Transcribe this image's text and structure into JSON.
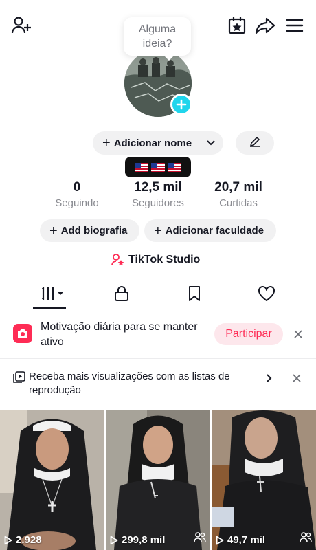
{
  "bubble": {
    "text": "Alguma ideia?"
  },
  "profile": {
    "add_name_label": "Adicionar nome",
    "flags": [
      "🇺🇸",
      "🇺🇸",
      "🇺🇸"
    ]
  },
  "stats": {
    "following": {
      "value": "0",
      "label": "Seguindo"
    },
    "followers": {
      "value": "12,5 mil",
      "label": "Seguidores"
    },
    "likes": {
      "value": "20,7 mil",
      "label": "Curtidas"
    }
  },
  "actions": {
    "bio_label": "Add biografia",
    "college_label": "Adicionar faculdade",
    "studio_label": "TikTok Studio"
  },
  "tabs": {
    "icons": [
      "grid-icon",
      "lock-icon",
      "bookmark-icon",
      "heart-icon"
    ],
    "active": "grid-icon"
  },
  "challenge_banner": {
    "text": "Motivação diária para se manter ativo",
    "button_label": "Participar"
  },
  "playlist_banner": {
    "text": "Receba mais visualizações com as listas de reprodução"
  },
  "videos": [
    {
      "views": "2.928",
      "friends_only": false
    },
    {
      "views": "299,8 mil",
      "friends_only": true
    },
    {
      "views": "49,7 mil",
      "friends_only": true
    }
  ],
  "colors": {
    "accent": "#fe2c55",
    "avatar_plus": "#20d5ec",
    "pill_bg": "#f1f1f2",
    "muted_text": "#8a8b91"
  }
}
